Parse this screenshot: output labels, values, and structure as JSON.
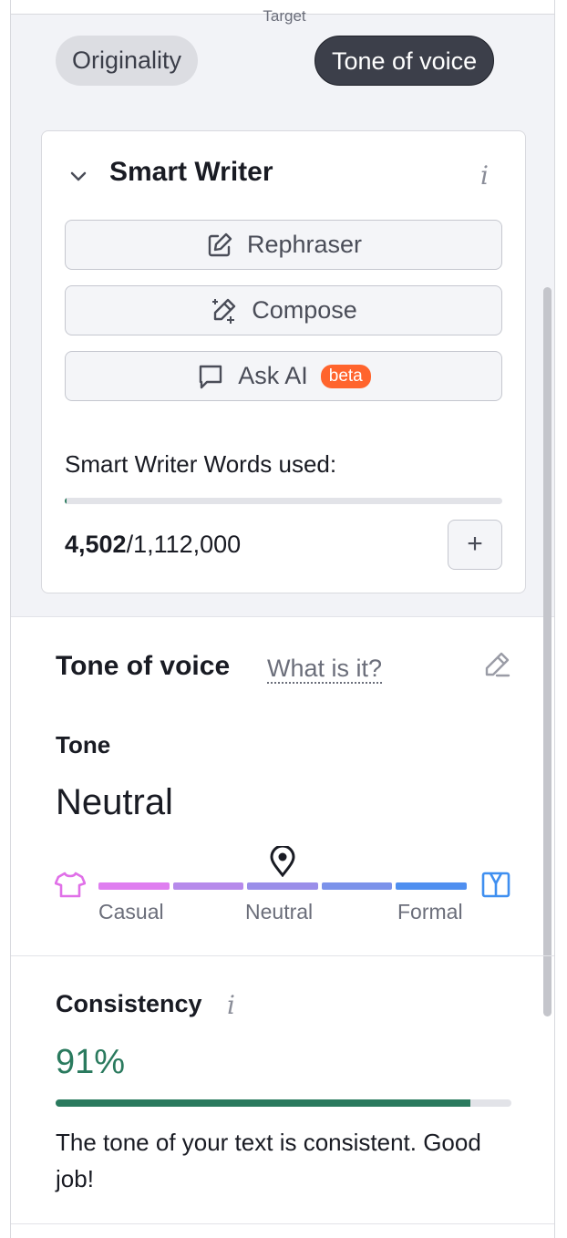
{
  "header": {
    "target_label": "Target",
    "chips": [
      {
        "label": "Originality",
        "active": false
      },
      {
        "label": "Tone of voice",
        "active": true
      }
    ]
  },
  "smart_writer": {
    "title": "Smart Writer",
    "info_icon": "i",
    "buttons": [
      {
        "label": "Rephraser",
        "icon": "edit-icon"
      },
      {
        "label": "Compose",
        "icon": "magic-pen-icon"
      },
      {
        "label": "Ask AI",
        "icon": "chat-bubble-icon",
        "badge": "beta"
      }
    ],
    "words_used_label": "Smart Writer Words used:",
    "words_used": "4,502",
    "words_total": "/1,112,000",
    "words_fraction": 0.004,
    "add_label": "+"
  },
  "tone_of_voice": {
    "title": "Tone of voice",
    "help_link": "What is it?",
    "tone_label": "Tone",
    "tone_value": "Neutral",
    "scale_labels": [
      "Casual",
      "Neutral",
      "Formal"
    ],
    "marker_position": 0.5,
    "scale_colors": [
      "#df7ef0",
      "#b68aeb",
      "#9a8ee9",
      "#7b92ea",
      "#4f8ff0"
    ]
  },
  "consistency": {
    "title": "Consistency",
    "info_icon": "i",
    "value": "91%",
    "fraction": 0.91,
    "message": "The tone of your text is consistent. Good job!"
  },
  "colors": {
    "accent_green": "#2a7a5e",
    "beta_orange": "#ff642d",
    "dark_chip": "#3c3f4a"
  }
}
